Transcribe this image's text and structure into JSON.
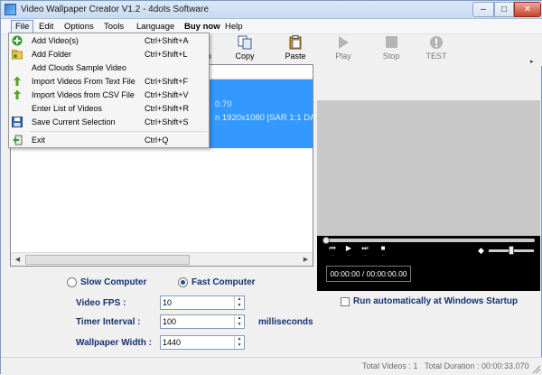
{
  "window": {
    "title": "Video Wallpaper Creator V1.2 - 4dots Software"
  },
  "menubar": [
    {
      "label": "File"
    },
    {
      "label": "Edit"
    },
    {
      "label": "Options"
    },
    {
      "label": "Tools"
    },
    {
      "label": "Language"
    },
    {
      "label": "Buy now"
    },
    {
      "label": "Help"
    }
  ],
  "toolbar": {
    "partial_label": "wn",
    "copy": "Copy",
    "paste": "Paste",
    "play": "Play",
    "stop": "Stop",
    "test": "TEST"
  },
  "file_menu": [
    {
      "label": "Add Video(s)",
      "shortcut": "Ctrl+Shift+A",
      "icon": "add-green-icon"
    },
    {
      "label": "Add Folder",
      "shortcut": "Ctrl+Shift+L",
      "icon": "folder-icon"
    },
    {
      "label": "Add Clouds Sample Video",
      "shortcut": "",
      "icon": ""
    },
    {
      "label": "Import Videos From Text File",
      "shortcut": "Ctrl+Shift+F",
      "icon": "import-icon"
    },
    {
      "label": "Import Videos from CSV File",
      "shortcut": "Ctrl+Shift+V",
      "icon": "import-icon"
    },
    {
      "label": "Enter List of Videos",
      "shortcut": "Ctrl+Shift+R",
      "icon": ""
    },
    {
      "label": "Save Current Selection",
      "shortcut": "Ctrl+Shift+S",
      "icon": "save-icon"
    },
    {
      "label": "Exit",
      "shortcut": "Ctrl+Q",
      "icon": "exit-icon"
    }
  ],
  "video_list": {
    "row_line1": "0.70",
    "row_line2": "n 1920x1080 [SAR 1:1 DAR"
  },
  "player": {
    "time": "00:00:00 / 00:00:00.00"
  },
  "options": {
    "slow_computer": "Slow Computer",
    "fast_computer": "Fast Computer",
    "selected": "fast_computer",
    "video_fps_label": "Video FPS :",
    "video_fps": "10",
    "timer_interval_label": "Timer Interval :",
    "timer_interval": "100",
    "timer_unit": "milliseconds",
    "wallpaper_width_label": "Wallpaper Width :",
    "wallpaper_width": "1440",
    "run_startup": "Run automatically at Windows Startup",
    "run_startup_checked": false
  },
  "status": {
    "total_videos": "Total Videos : 1",
    "total_duration": "Total Duration : 00:00:33.070"
  }
}
